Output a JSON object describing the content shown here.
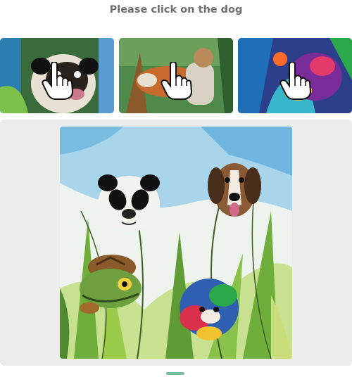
{
  "prompt": {
    "text": "Please click on the dog"
  },
  "examples": [
    {
      "subject": "pug-with-pointer"
    },
    {
      "subject": "brown-dog-with-pointer"
    },
    {
      "subject": "colorful-dog-with-pointer"
    }
  ],
  "pointer_icon": "hand-pointer-icon",
  "puzzle": {
    "critters": [
      {
        "id": "panda",
        "label": "panda"
      },
      {
        "id": "dog",
        "label": "dog"
      },
      {
        "id": "turtle",
        "label": "turtle"
      },
      {
        "id": "parrot",
        "label": "parrot"
      }
    ]
  },
  "colors": {
    "panel_bg": "#ececec",
    "prompt_text": "#6e6e6e",
    "sky": "#a9d5ea",
    "grass": "#6fae3a"
  }
}
